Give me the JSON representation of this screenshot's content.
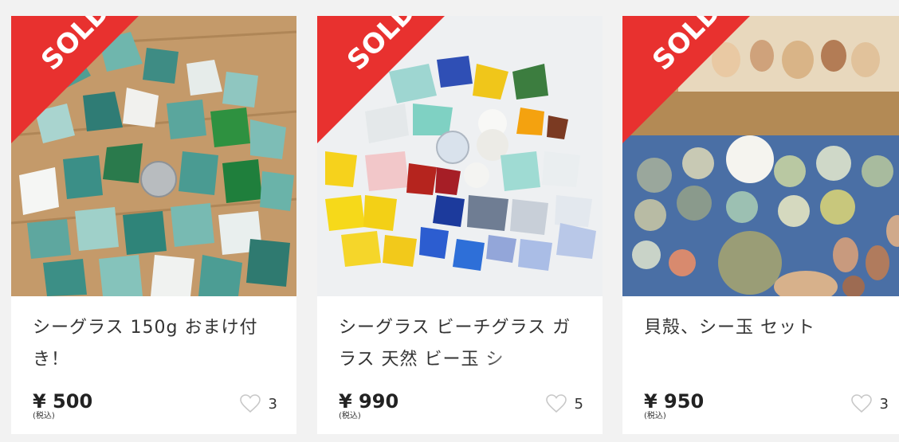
{
  "items": [
    {
      "title": "シーグラス 150g おまけ付き！",
      "price": "¥ 500",
      "tax_note": "(税込)",
      "likes": "3",
      "status": "SOLD",
      "image_icon": "sea-glass-photo"
    },
    {
      "title": "シーグラス ビーチグラス ガラス 天然 ビー玉 シ",
      "price": "¥ 990",
      "tax_note": "(税込)",
      "likes": "5",
      "status": "SOLD",
      "image_icon": "sea-glass-marbles-photo"
    },
    {
      "title": "貝殻、シー玉 セット",
      "price": "¥ 950",
      "tax_note": "(税込)",
      "likes": "3",
      "status": "SOLD",
      "image_icon": "shells-and-sea-marbles-photo"
    }
  ],
  "colors": {
    "sold_ribbon": "#e8312f",
    "background": "#f2f2f2",
    "card": "#ffffff",
    "heart_outline": "#c8c8c8"
  }
}
